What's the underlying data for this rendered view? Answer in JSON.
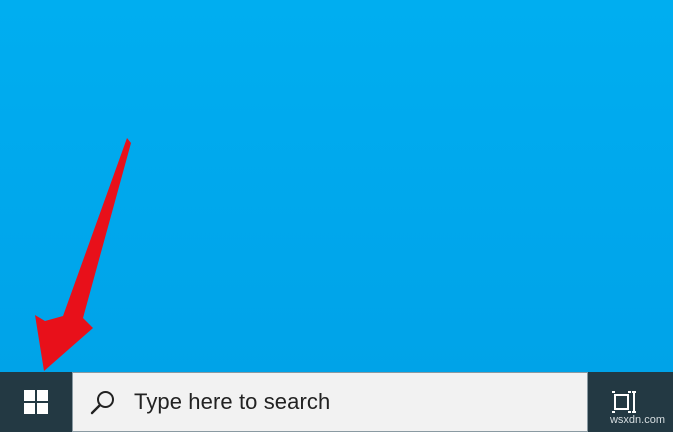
{
  "taskbar": {
    "start_icon": "windows-logo-icon",
    "search": {
      "icon": "search-icon",
      "placeholder": "Type here to search"
    },
    "task_view_icon": "task-view-icon"
  },
  "annotation": {
    "arrow_color": "#e8101a",
    "target": "start-button"
  },
  "watermark": "wsxdn.com",
  "colors": {
    "desktop": "#00a8ec",
    "taskbar": "#233943",
    "search_bg": "#f2f2f2"
  }
}
